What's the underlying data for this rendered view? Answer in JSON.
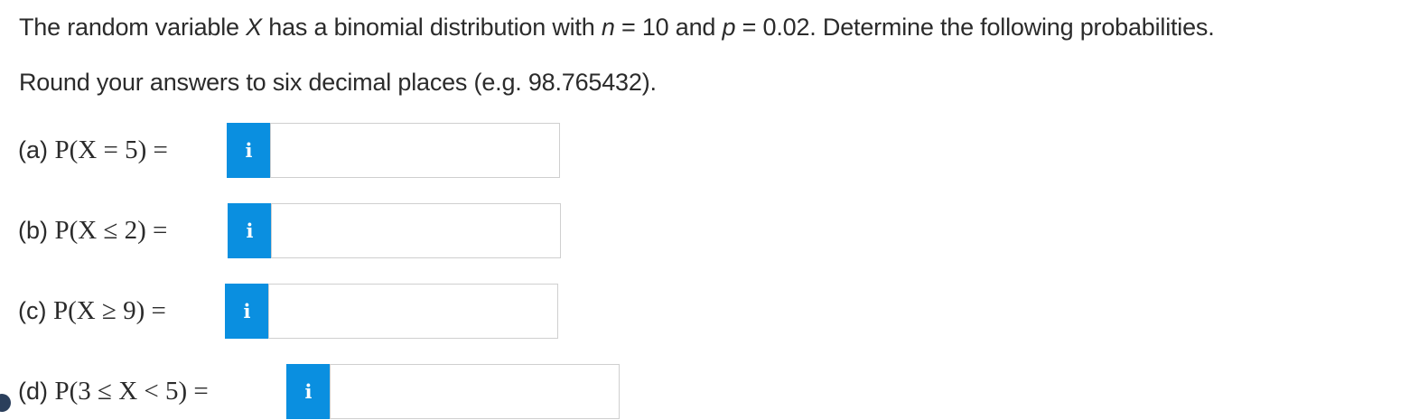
{
  "problem": {
    "line1_pre": "The random variable ",
    "var_x": "X",
    "line1_mid": " has a binomial distribution with ",
    "var_n": "n",
    "n_eq": " = 10 and ",
    "var_p": "p",
    "p_eq": " = 0.02. Determine the following probabilities.",
    "line2": "Round your answers to six decimal places (e.g. 98.765432)."
  },
  "parts": [
    {
      "label": "(a) ",
      "expr": "P(X  =  5)  =",
      "info": "i",
      "value": ""
    },
    {
      "label": "(b) ",
      "expr": "P(X  ≤  2)  =",
      "info": "i",
      "value": ""
    },
    {
      "label": "(c) ",
      "expr": "P(X  ≥  9)  =",
      "info": "i",
      "value": ""
    },
    {
      "label": "(d) ",
      "expr": "P(3  ≤  X  <  5)  =",
      "info": "i",
      "value": ""
    }
  ],
  "colors": {
    "info_button": "#0a8fe0",
    "text": "#2b2b2b",
    "input_border": "#cfcfcf"
  }
}
